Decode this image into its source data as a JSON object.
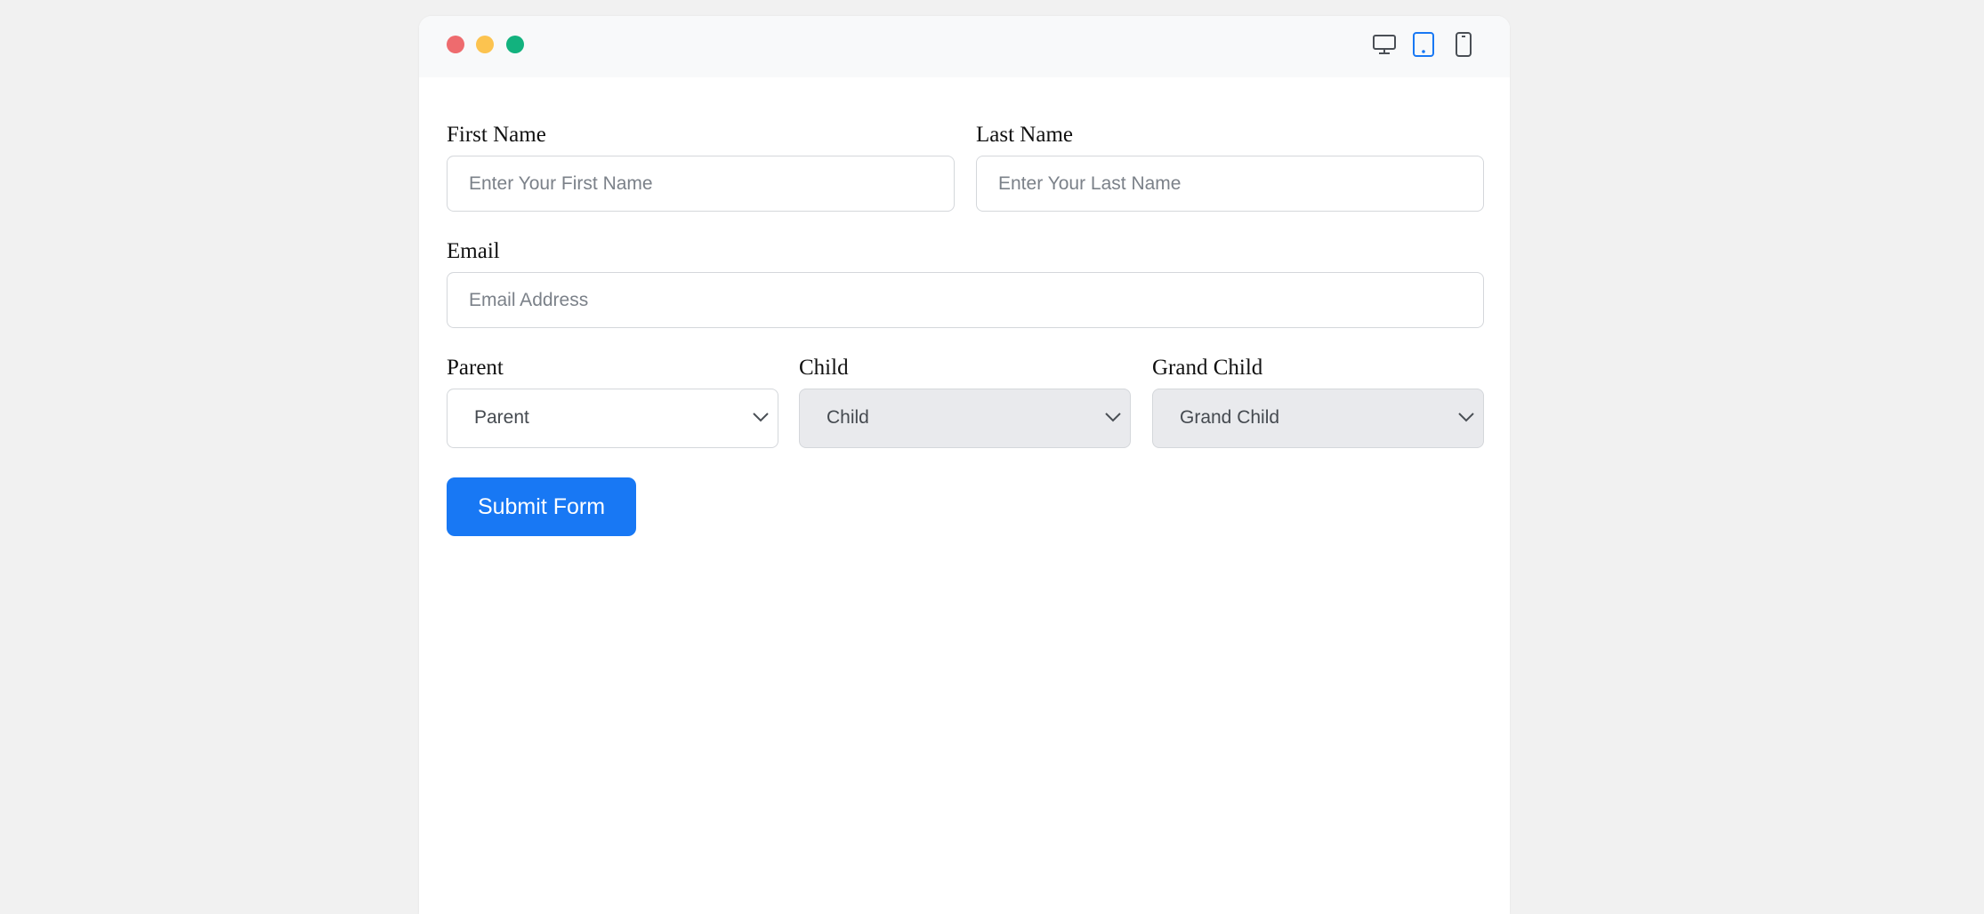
{
  "window": {
    "controls": [
      "close-dot",
      "minimize-dot",
      "maximize-dot"
    ],
    "device_toggles": [
      {
        "name": "desktop-icon",
        "active": false
      },
      {
        "name": "tablet-icon",
        "active": true
      },
      {
        "name": "mobile-icon",
        "active": false
      }
    ]
  },
  "form": {
    "first_name": {
      "label": "First Name",
      "placeholder": "Enter Your First Name",
      "value": ""
    },
    "last_name": {
      "label": "Last Name",
      "placeholder": "Enter Your Last Name",
      "value": ""
    },
    "email": {
      "label": "Email",
      "placeholder": "Email Address",
      "value": ""
    },
    "parent": {
      "label": "Parent",
      "selected": "Parent",
      "disabled": false
    },
    "child": {
      "label": "Child",
      "selected": "Child",
      "disabled": true
    },
    "grand_child": {
      "label": "Grand Child",
      "selected": "Grand Child",
      "disabled": true
    },
    "submit_label": "Submit Form"
  },
  "colors": {
    "accent": "#1878f4",
    "close": "#ee6b6e",
    "minimize": "#fcc34f",
    "maximize": "#12b27e"
  }
}
